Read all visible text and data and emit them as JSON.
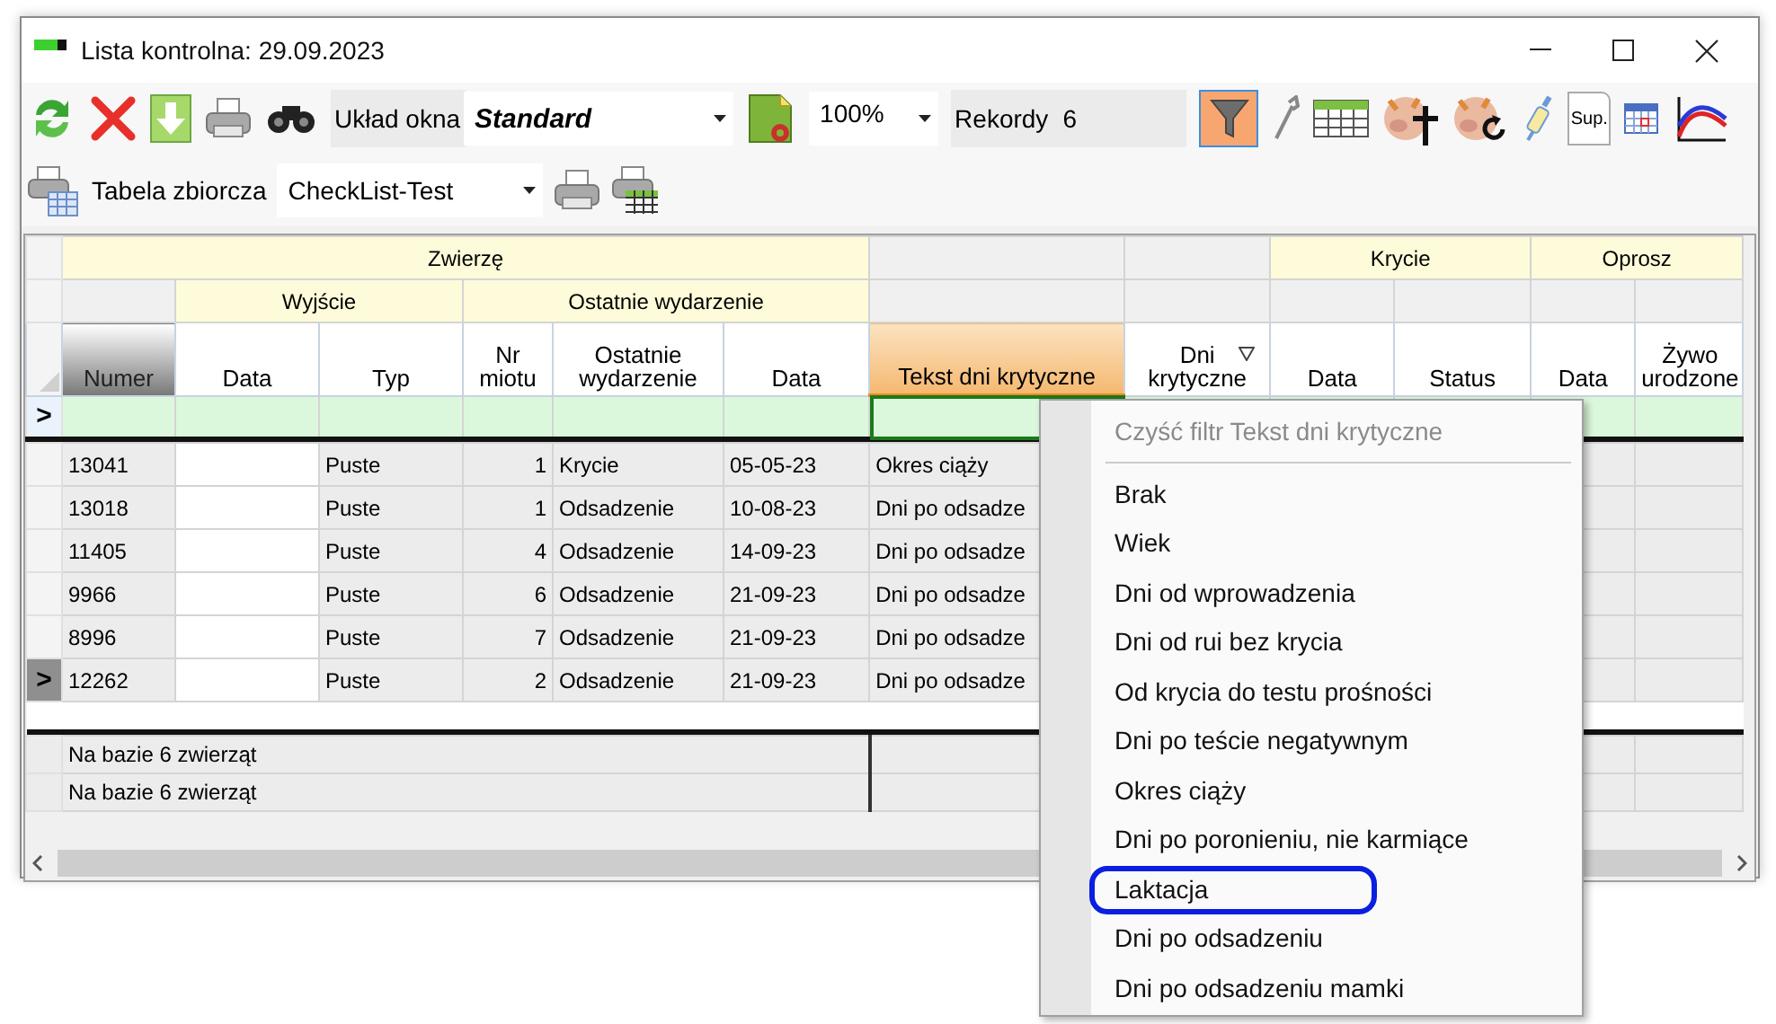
{
  "window": {
    "title": "Lista kontrolna: 29.09.2023"
  },
  "toolbar": {
    "layout_label": "Układ okna",
    "layout_value": "Standard",
    "zoom_value": "100%",
    "records_label": "Rekordy",
    "records_value": "6",
    "filter_on": true,
    "sup_label": "Sup."
  },
  "toolbar2": {
    "summary_label": "Tabela zbiorcza",
    "summary_value": "CheckList-Test"
  },
  "table": {
    "groups": [
      {
        "label": "Zwierzę",
        "subgroups": [
          {
            "columns": [
              {
                "label": "Numer",
                "frozen": true,
                "selected": false,
                "filter": false,
                "kind": "text"
              }
            ]
          },
          {
            "label": "Wyjście",
            "columns": [
              {
                "label": "Data",
                "frozen": false,
                "selected": false,
                "filter": false,
                "kind": "input"
              },
              {
                "label": "Typ",
                "frozen": false,
                "selected": false,
                "filter": false,
                "kind": "text"
              }
            ]
          },
          {
            "label": "Ostatnie wydarzenie",
            "columns": [
              {
                "label": "Nr\nmiotu",
                "frozen": false,
                "selected": false,
                "filter": false,
                "kind": "number"
              },
              {
                "label": "Ostatnie\nwydarzenie",
                "frozen": false,
                "selected": false,
                "filter": false,
                "kind": "text"
              },
              {
                "label": "Data",
                "frozen": false,
                "selected": false,
                "filter": false,
                "kind": "text"
              }
            ]
          }
        ]
      },
      {
        "subgroups": [
          {
            "columns": [
              {
                "label": "Tekst dni krytyczne",
                "frozen": false,
                "selected": true,
                "filter": false,
                "kind": "text"
              }
            ]
          },
          {
            "columns": [
              {
                "label": "Dni\nkrytyczne",
                "frozen": false,
                "selected": false,
                "filter": true,
                "kind": "number"
              }
            ]
          }
        ]
      },
      {
        "label": "Krycie",
        "subgroups": [
          {
            "columns": [
              {
                "label": "Data",
                "frozen": false,
                "selected": false,
                "filter": false,
                "kind": "text"
              }
            ]
          },
          {
            "columns": [
              {
                "label": "Status",
                "frozen": false,
                "selected": false,
                "filter": false,
                "kind": "text"
              }
            ]
          }
        ]
      },
      {
        "label": "Oprosz",
        "subgroups": [
          {
            "columns": [
              {
                "label": "Data",
                "frozen": false,
                "selected": false,
                "filter": false,
                "kind": "text"
              }
            ]
          },
          {
            "columns": [
              {
                "label": "Żywo\nurodzone",
                "frozen": false,
                "selected": false,
                "filter": false,
                "kind": "number"
              }
            ]
          }
        ]
      }
    ],
    "filter_row": {
      "marker": ">"
    },
    "row_marker": ">",
    "rows": [
      {
        "cells": [
          "13041",
          null,
          "Puste",
          "1",
          "Krycie",
          "05-05-23",
          "Okres ciąży"
        ],
        "current": false
      },
      {
        "cells": [
          "13018",
          null,
          "Puste",
          "1",
          "Odsadzenie",
          "10-08-23",
          "Dni po odsadze"
        ],
        "current": false
      },
      {
        "cells": [
          "11405",
          null,
          "Puste",
          "4",
          "Odsadzenie",
          "14-09-23",
          "Dni po odsadze"
        ],
        "current": false
      },
      {
        "cells": [
          "9966",
          null,
          "Puste",
          "6",
          "Odsadzenie",
          "21-09-23",
          "Dni po odsadze"
        ],
        "current": false
      },
      {
        "cells": [
          "8996",
          null,
          "Puste",
          "7",
          "Odsadzenie",
          "21-09-23",
          "Dni po odsadze"
        ],
        "current": false
      },
      {
        "cells": [
          "12262",
          null,
          "Puste",
          "2",
          "Odsadzenie",
          "21-09-23",
          "Dni po odsadze"
        ],
        "current": true
      }
    ],
    "summary": [
      {
        "text": "Na bazie 6 zwierząt"
      },
      {
        "text": "Na bazie 6 zwierząt"
      }
    ]
  },
  "menu": {
    "clear_item": {
      "label": "Czyść filtr Tekst dni krytyczne",
      "disabled": true
    },
    "items": [
      {
        "label": "Brak",
        "highlighted": false
      },
      {
        "label": "Wiek",
        "highlighted": false
      },
      {
        "label": "Dni od wprowadzenia",
        "highlighted": false
      },
      {
        "label": "Dni od rui bez krycia",
        "highlighted": false
      },
      {
        "label": "Od krycia do testu prośności",
        "highlighted": false
      },
      {
        "label": "Dni po teście negatywnym",
        "highlighted": false
      },
      {
        "label": "Okres ciąży",
        "highlighted": false
      },
      {
        "label": "Dni po poronieniu, nie karmiące",
        "highlighted": false
      },
      {
        "label": "Laktacja",
        "highlighted": true
      },
      {
        "label": "Dni po odsadzeniu",
        "highlighted": false
      },
      {
        "label": "Dni po odsadzeniu mamki",
        "highlighted": false
      }
    ]
  }
}
